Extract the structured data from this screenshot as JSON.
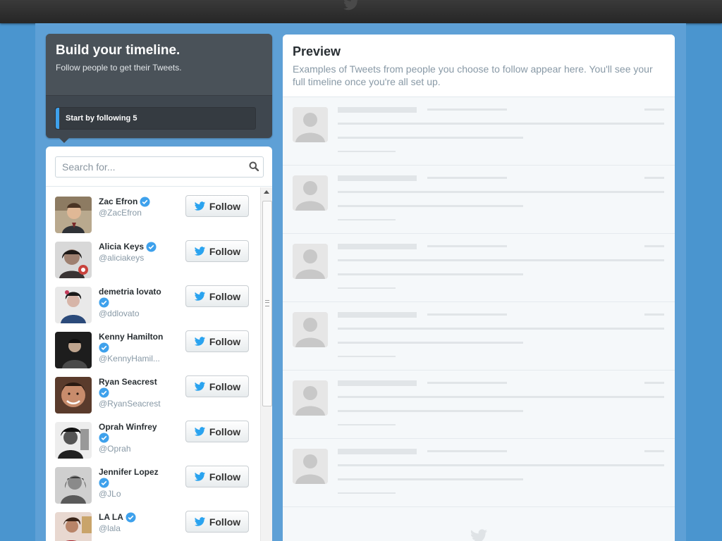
{
  "header": {
    "title": "Build your timeline.",
    "subtitle": "Follow people to get their Tweets.",
    "progress_label": "Start by following 5"
  },
  "search": {
    "placeholder": "Search for..."
  },
  "follow_label": "Follow",
  "users": [
    {
      "name": "Zac Efron",
      "handle": "@ZacEfron",
      "verified": true
    },
    {
      "name": "Alicia Keys",
      "handle": "@aliciakeys",
      "verified": true
    },
    {
      "name": "demetria lovato",
      "handle": "@ddlovato",
      "verified": true
    },
    {
      "name": "Kenny Hamilton",
      "handle": "@KennyHamil...",
      "verified": true
    },
    {
      "name": "Ryan Seacrest",
      "handle": "@RyanSeacrest",
      "verified": true
    },
    {
      "name": "Oprah Winfrey",
      "handle": "@Oprah",
      "verified": true
    },
    {
      "name": "Jennifer Lopez",
      "handle": "@JLo",
      "verified": true
    },
    {
      "name": "LA LA",
      "handle": "@lala",
      "verified": true
    }
  ],
  "preview": {
    "title": "Preview",
    "description": "Examples of Tweets from people you choose to follow appear here. You'll see your full timeline once you're all set up."
  },
  "colors": {
    "background": "#4a95cf",
    "accent": "#3ea1ec",
    "dark_panel": "#3f474f"
  },
  "icons": {
    "search": "search-icon",
    "verified": "verified-badge-icon",
    "follow": "twitter-bird-icon"
  }
}
